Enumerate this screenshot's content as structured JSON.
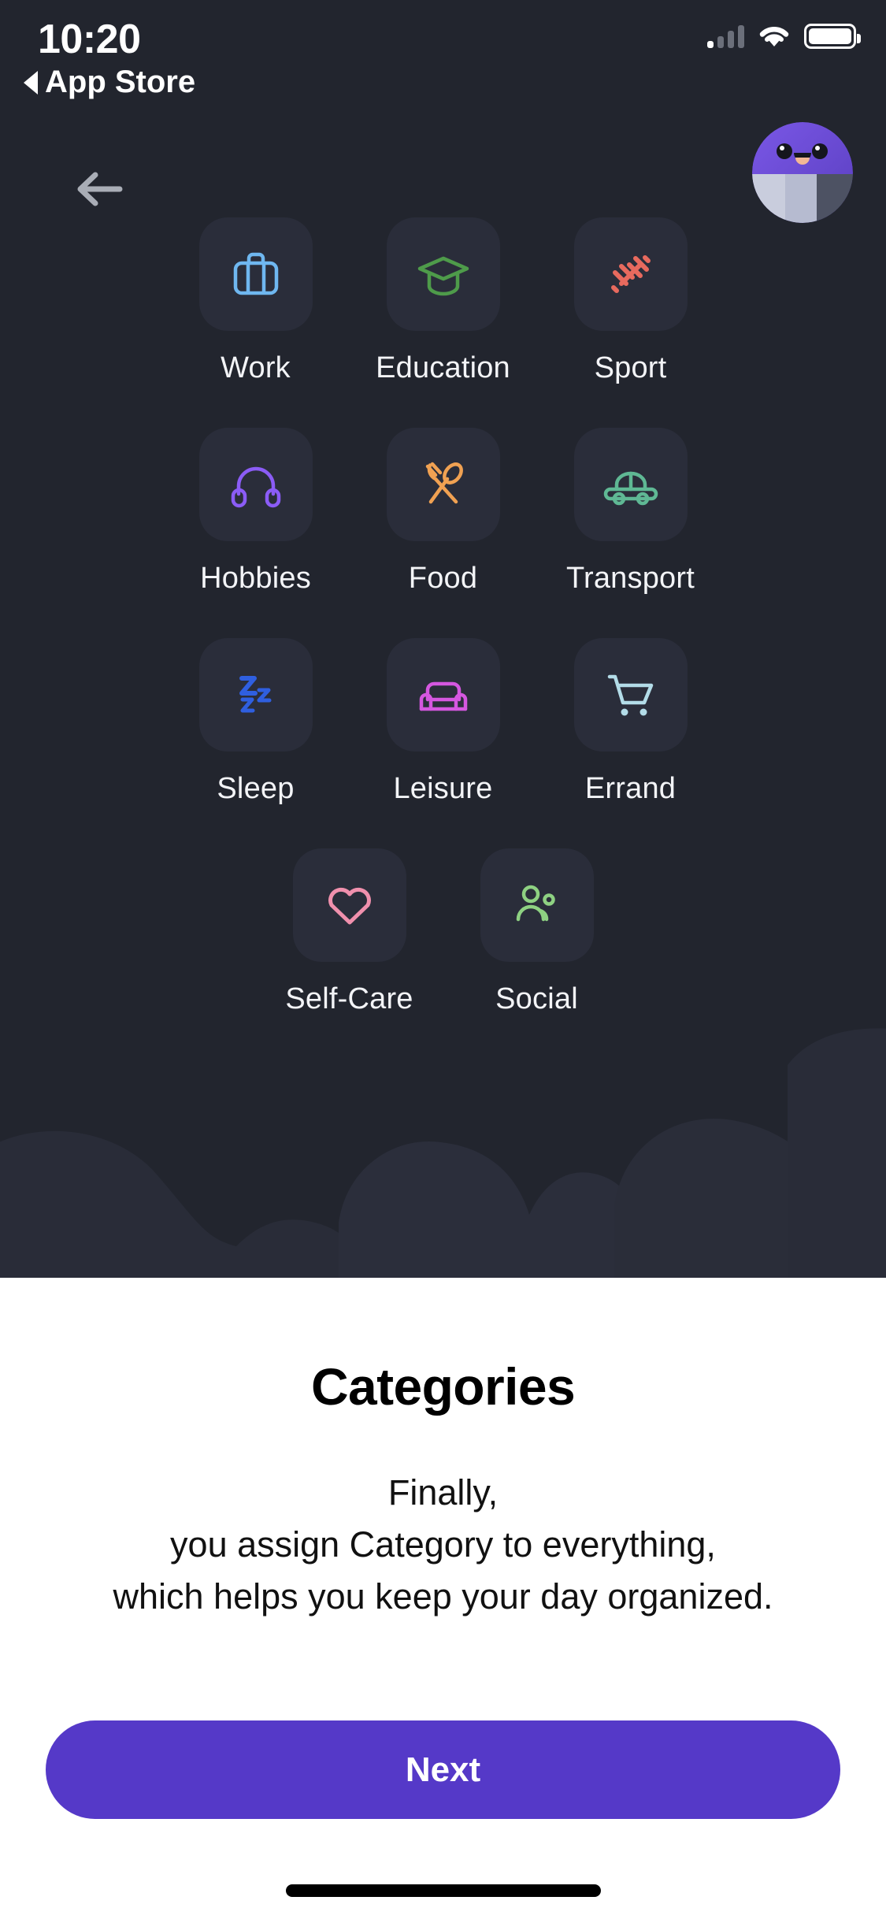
{
  "status_bar": {
    "time": "10:20",
    "back_app_label": "App Store",
    "back_triangle_icon": "triangle-left-icon",
    "signal_icon": "cellular-signal-icon",
    "wifi_icon": "wifi-icon",
    "battery_icon": "battery-full-icon"
  },
  "header": {
    "back_arrow_icon": "arrow-left-icon",
    "avatar_icon": "user-avatar-icon"
  },
  "categories": {
    "rows": [
      [
        {
          "label": "Work",
          "icon": "briefcase-icon",
          "color": "#6fb7f0"
        },
        {
          "label": "Education",
          "icon": "graduation-cap-icon",
          "color": "#4e9b4a"
        },
        {
          "label": "Sport",
          "icon": "dumbbell-icon",
          "color": "#e86a5e"
        }
      ],
      [
        {
          "label": "Hobbies",
          "icon": "headphones-icon",
          "color": "#8b5cf6"
        },
        {
          "label": "Food",
          "icon": "fork-spoon-icon",
          "color": "#f0a152"
        },
        {
          "label": "Transport",
          "icon": "car-icon",
          "color": "#5fb894"
        }
      ],
      [
        {
          "label": "Sleep",
          "icon": "zzz-sleep-icon",
          "color": "#2f5fe0"
        },
        {
          "label": "Leisure",
          "icon": "sofa-icon",
          "color": "#d557e0"
        },
        {
          "label": "Errand",
          "icon": "shopping-cart-icon",
          "color": "#b3dce8"
        }
      ],
      [
        {
          "label": "Self-Care",
          "icon": "heart-icon",
          "color": "#f090ad"
        },
        {
          "label": "Social",
          "icon": "people-icon",
          "color": "#8ed182"
        }
      ]
    ]
  },
  "sheet": {
    "title": "Categories",
    "description_line_1": "Finally,",
    "description_line_2": "you assign Category to everything,",
    "description_line_3": "which helps you keep your day organized.",
    "next_label": "Next"
  },
  "colors": {
    "background_dark": "#22252e",
    "tile": "#2a2d3a",
    "accent_purple": "#5539c8",
    "sheet_background": "#ffffff"
  }
}
